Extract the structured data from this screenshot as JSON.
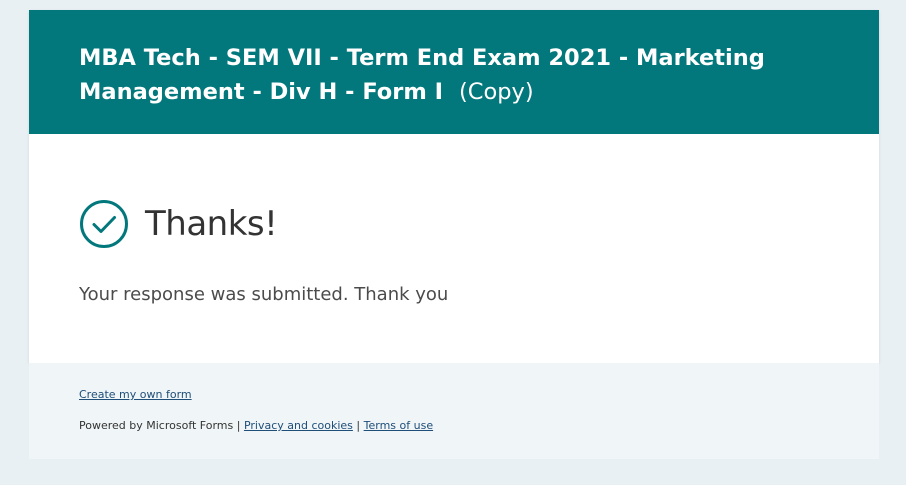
{
  "form": {
    "title": "MBA Tech - SEM VII - Term End Exam 2021 - Marketing Management - Div H - Form I",
    "title_suffix": "(Copy)"
  },
  "confirmation": {
    "icon": "checkmark-circle-icon",
    "heading": "Thanks!",
    "message": "Your response was submitted. Thank you"
  },
  "footer": {
    "create_link": "Create my own form",
    "powered_by": "Powered by Microsoft Forms |",
    "privacy_link": "Privacy and cookies",
    "separator": "|",
    "terms_link": "Terms of use"
  },
  "colors": {
    "header_bg": "#03787c",
    "page_bg": "#e9f0f3",
    "footer_bg": "#f0f5f7",
    "link": "#1f4e79"
  }
}
